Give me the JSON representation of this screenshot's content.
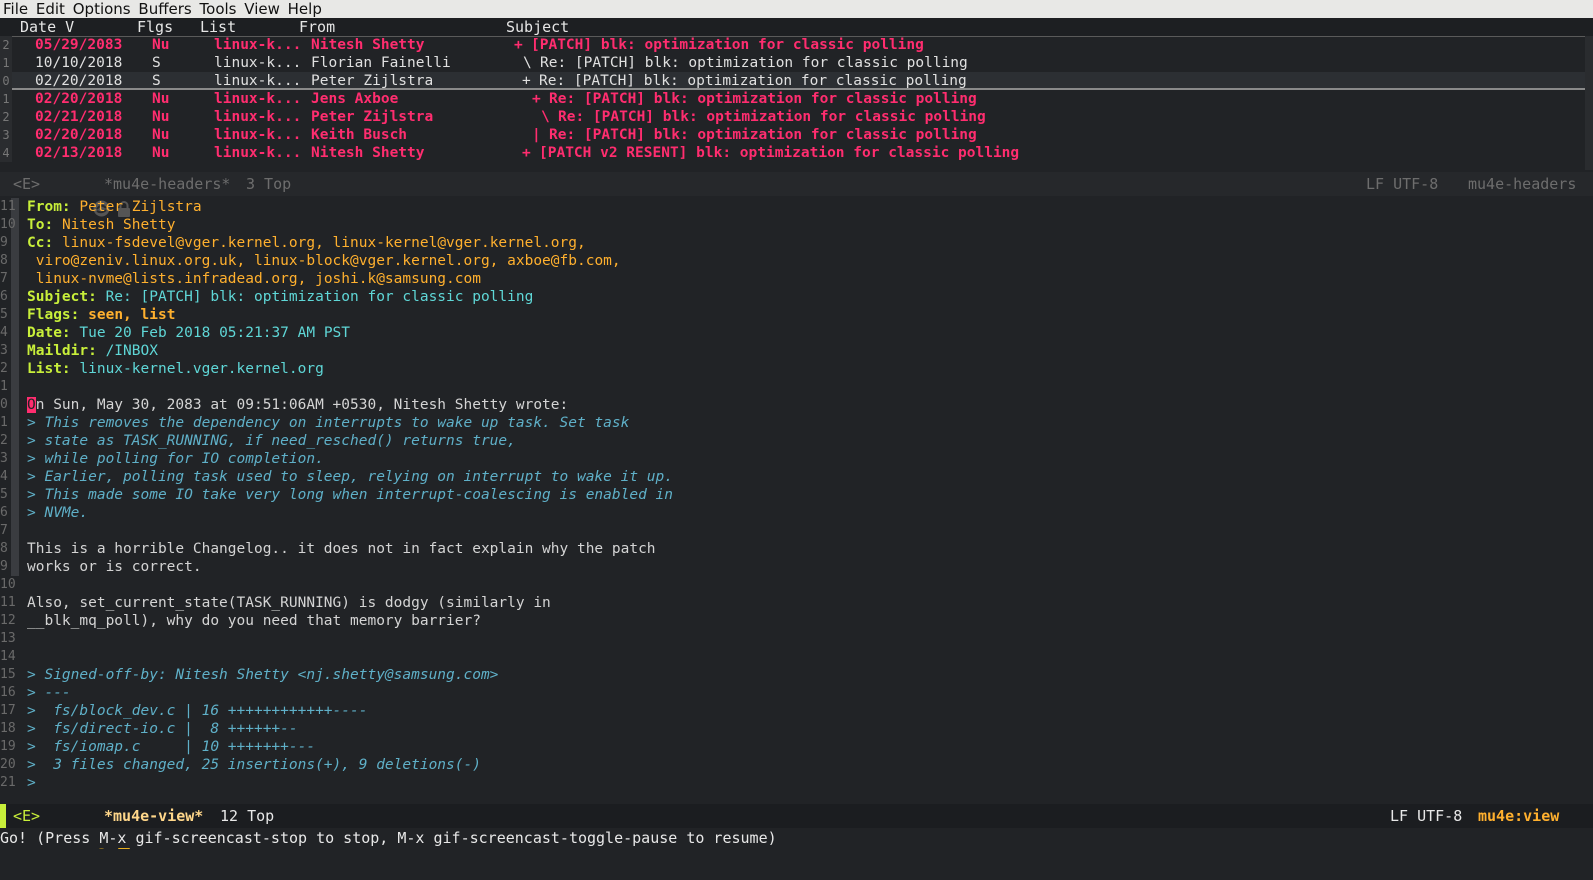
{
  "menubar": {
    "items": [
      "File",
      "Edit",
      "Options",
      "Buffers",
      "Tools",
      "View",
      "Help"
    ]
  },
  "headers": {
    "columns": {
      "date": "Date V",
      "flags": "Flgs",
      "list": "List",
      "from": "From",
      "subject": "Subject"
    },
    "rows": [
      {
        "ln": "2",
        "date": "05/29/2083",
        "flags": "Nu",
        "list": "linux-k...",
        "from": "Nitesh Shetty",
        "thread": "+",
        "subject": "[PATCH] blk: optimization for classic polling",
        "unread": true
      },
      {
        "ln": "1",
        "date": "10/10/2018",
        "flags": "S",
        "list": "linux-k...",
        "from": "Florian Fainelli",
        "thread": "\\",
        "subject": "Re: [PATCH] blk: optimization for classic polling",
        "unread": false
      },
      {
        "ln": "0",
        "date": "02/20/2018",
        "flags": "S",
        "list": "linux-k...",
        "from": "Peter Zijlstra",
        "thread": "+",
        "subject": "Re: [PATCH] blk: optimization for classic polling",
        "unread": false
      },
      {
        "ln": "1",
        "date": "02/20/2018",
        "flags": "Nu",
        "list": "linux-k...",
        "from": "Jens Axboe",
        "thread": "+",
        "subject": "Re: [PATCH] blk: optimization for classic polling",
        "unread": true
      },
      {
        "ln": "2",
        "date": "02/21/2018",
        "flags": "Nu",
        "list": "linux-k...",
        "from": "Peter Zijlstra",
        "thread": "\\",
        "subject": "Re: [PATCH] blk: optimization for classic polling",
        "unread": true
      },
      {
        "ln": "3",
        "date": "02/20/2018",
        "flags": "Nu",
        "list": "linux-k...",
        "from": "Keith Busch",
        "thread": "|",
        "subject": "Re: [PATCH] blk: optimization for classic polling",
        "unread": true
      },
      {
        "ln": "4",
        "date": "02/13/2018",
        "flags": "Nu",
        "list": "linux-k...",
        "from": "Nitesh Shetty",
        "thread": "+",
        "subject": "[PATCH v2 RESENT] blk: optimization for classic polling",
        "unread": true
      }
    ]
  },
  "modeline_headers": {
    "state": "<E>",
    "buffer": "*mu4e-headers*",
    "pos": "3 Top",
    "encoding": "LF UTF-8",
    "mode": "mu4e-headers"
  },
  "view": {
    "from_label": "From:",
    "from": "Peter Zijlstra",
    "to_label": "To:",
    "to": "Nitesh Shetty",
    "cc_label": "Cc:",
    "cc_line1": "linux-fsdevel@vger.kernel.org, linux-kernel@vger.kernel.org,",
    "cc_line2": "viro@zeniv.linux.org.uk, linux-block@vger.kernel.org, axboe@fb.com,",
    "cc_line3": "linux-nvme@lists.infradead.org, joshi.k@samsung.com",
    "subject_label": "Subject:",
    "subject": "Re: [PATCH] blk: optimization for classic polling",
    "flags_label": "Flags:",
    "flags": "seen, list",
    "date_label": "Date:",
    "date": "Tue 20 Feb 2018 05:21:37 AM PST",
    "maildir_label": "Maildir:",
    "maildir": "/INBOX",
    "list_label": "List:",
    "list": "linux-kernel.vger.kernel.org",
    "wrote_first": "O",
    "wrote_rest": "n Sun, May 30, 2083 at 09:51:06AM +0530, Nitesh Shetty wrote:",
    "q1": "> This removes the dependency on interrupts to wake up task. Set task",
    "q2": "> state as TASK_RUNNING, if need_resched() returns true,",
    "q3": "> while polling for IO completion.",
    "q4": "> Earlier, polling task used to sleep, relying on interrupt to wake it up.",
    "q5": "> This made some IO take very long when interrupt-coalescing is enabled in",
    "q6": "> NVMe.",
    "b1": "This is a horrible Changelog.. it does not in fact explain why the patch",
    "b2": "works or is correct.",
    "b3": "Also, set_current_state(TASK_RUNNING) is dodgy (similarly in",
    "b4": "__blk_mq_poll), why do you need that memory barrier?",
    "s1": "> Signed-off-by: Nitesh Shetty <nj.shetty@samsung.com>",
    "s2": "> ---",
    "s3": ">  fs/block_dev.c | 16 ++++++++++++----",
    "s4": ">  fs/direct-io.c |  8 ++++++--",
    "s5": ">  fs/iomap.c     | 10 +++++++---",
    "s6": ">  3 files changed, 25 insertions(+), 9 deletions(-)",
    "s7": ">",
    "ln": {
      "l11": "11",
      "l10": "10",
      "l9": "9",
      "l8": "8",
      "l7": "7",
      "l6": "6",
      "l5": "5",
      "l4": "4",
      "l3": "3",
      "l2": "2",
      "l1": "1",
      "l0": "0",
      "m1": "1",
      "m2": "2",
      "m3": "3",
      "m4": "4",
      "m5": "5",
      "m6": "6",
      "m7": "7",
      "m8": "8",
      "m9": "9",
      "m10": "10",
      "m11": "11",
      "m12": "12",
      "m13": "13",
      "m14": "14",
      "m15": "15",
      "m16": "16",
      "m17": "17",
      "m18": "18",
      "m19": "19",
      "m20": "20",
      "m21": "21"
    }
  },
  "modeline_view": {
    "state": "<E>",
    "buffer": "*mu4e-view*",
    "pos": "12 Top",
    "encoding": "LF UTF-8",
    "mode": "mu4e:view"
  },
  "echo": "Go! (Press M-x gif-screencast-stop to stop, M-x gif-screencast-toggle-pause to resume)",
  "colors": {
    "unread": "#ff2d6f",
    "field": "#c8ef3a",
    "value": "#ffb02e",
    "quote": "#5fb0c8",
    "bg": "#212326"
  }
}
